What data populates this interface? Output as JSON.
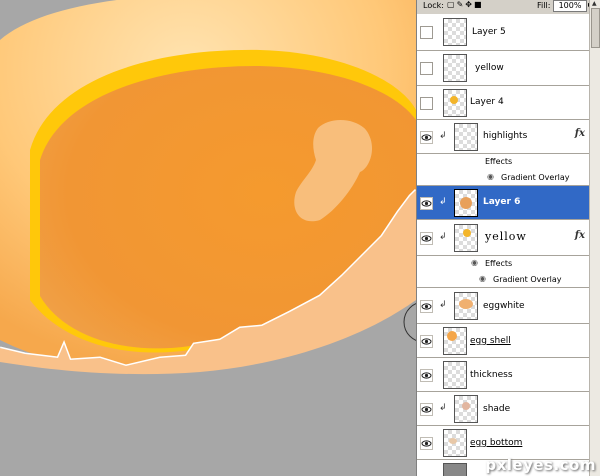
{
  "lock_bar": {
    "lock_label": "Lock:",
    "fill_label": "Fill:",
    "fill_value": "100%"
  },
  "icons": {
    "lock_transparency": "lock-transparency-icon",
    "lock_paint": "lock-paint-icon",
    "lock_move": "lock-move-icon",
    "lock_all": "lock-all-icon",
    "visibility": "eye-icon",
    "clip": "clip-arrow-icon",
    "effects": "fx-icon"
  },
  "layers": [
    {
      "name": "Layer 5",
      "visible": false
    },
    {
      "name": "yellow",
      "visible": false
    },
    {
      "name": "Layer 4",
      "visible": false
    },
    {
      "name": "highlights",
      "visible": true,
      "clipped": true,
      "fx": "fx",
      "effects_label": "Effects",
      "effect": "Gradient Overlay"
    },
    {
      "name": "Layer 6",
      "visible": true,
      "clipped": true,
      "selected": true
    },
    {
      "name": "yellow",
      "visible": true,
      "clipped": true,
      "fx": "fx",
      "effects_label": "Effects",
      "effect": "Gradient Overlay"
    },
    {
      "name": "eggwhite",
      "visible": true,
      "clipped": true
    },
    {
      "name": "egg shell",
      "visible": true
    },
    {
      "name": "thickness",
      "visible": true
    },
    {
      "name": "shade",
      "visible": true,
      "clipped": true
    },
    {
      "name": "egg bottom",
      "visible": true
    }
  ],
  "watermark": "pxleyes.com",
  "colors": {
    "selected": "#3169c6",
    "yolk": "#f39a35",
    "shell": "#ffd59a",
    "canvas_bg": "#a7a7a7"
  }
}
